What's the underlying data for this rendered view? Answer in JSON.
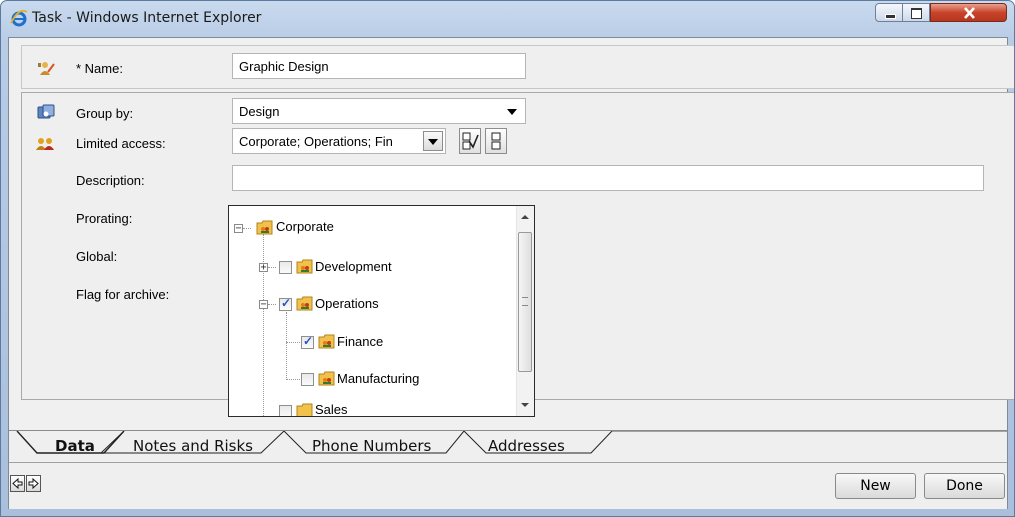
{
  "window": {
    "title": "Task - Windows Internet Explorer"
  },
  "form": {
    "name_label": "* Name:",
    "name_value": "Graphic Design",
    "group_by_label": "Group by:",
    "group_by_value": "Design",
    "limited_access_label": "Limited access:",
    "limited_access_value": "Corporate; Operations; Fin",
    "description_label": "Description:",
    "prorating_label": "Prorating:",
    "global_label": "Global:",
    "flag_for_archive_label": "Flag for archive:"
  },
  "tree": {
    "root": {
      "label": "Corporate",
      "expanded": true
    },
    "items": [
      {
        "label": "Development",
        "checked": false,
        "expander": "+"
      },
      {
        "label": "Operations",
        "checked": true,
        "expander": "−"
      },
      {
        "label": "Finance",
        "checked": true
      },
      {
        "label": "Manufacturing",
        "checked": false
      }
    ],
    "partial_label": "Sales"
  },
  "tabs": [
    {
      "label": "Data",
      "active": true
    },
    {
      "label": "Notes and Risks",
      "active": false
    },
    {
      "label": "Phone Numbers",
      "active": false
    },
    {
      "label": "Addresses",
      "active": false
    }
  ],
  "buttons": {
    "new": "New",
    "done": "Done"
  },
  "icons": {
    "name_row": "user-pen-icon",
    "group_row": "group-icon",
    "access_row": "people-icon",
    "folder": "folder-group-icon"
  }
}
